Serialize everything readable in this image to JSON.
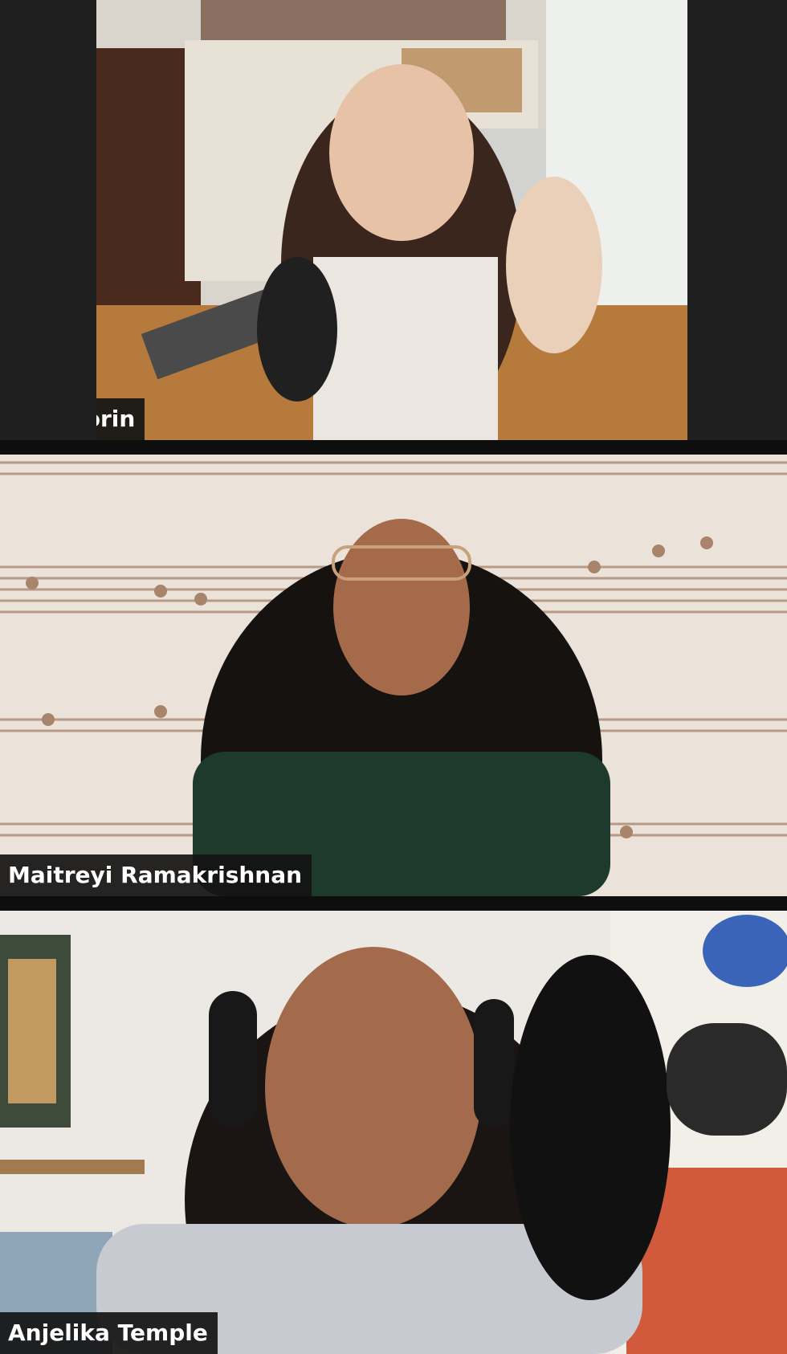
{
  "window": {
    "view_mode": "gallery",
    "accent_color": "#1f1f1f"
  },
  "participants": [
    {
      "name": "Brit Morin",
      "video_description": "woman with long dark hair making a hand gesture beside a microphone with shelves behind",
      "icon": "video-feed"
    },
    {
      "name": "Maitreyi Ramakrishnan",
      "video_description": "smiling woman wearing glasses and a headset in front of a sheet-music wallpaper",
      "icon": "video-feed"
    },
    {
      "name": "Anjelika Temple",
      "video_description": "laughing woman wearing headphones next to a pop filter and microphone",
      "icon": "video-feed"
    }
  ]
}
